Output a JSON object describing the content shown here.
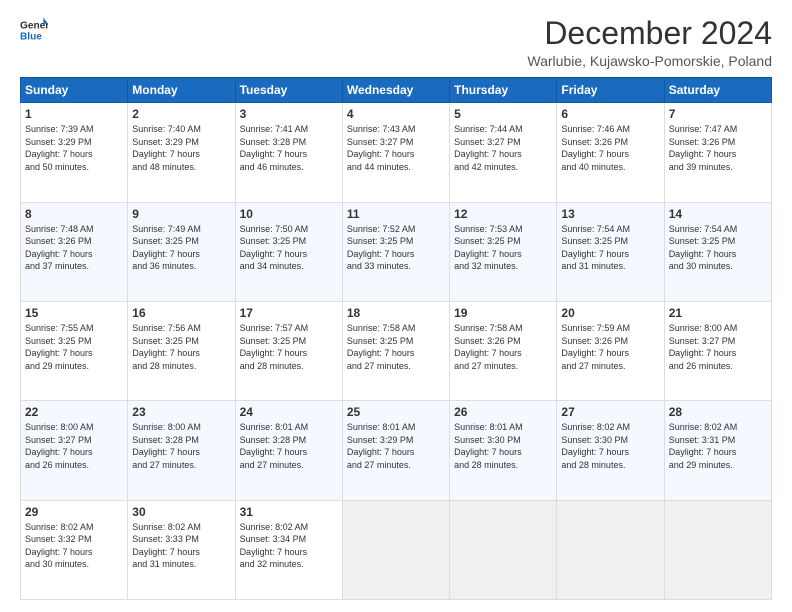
{
  "header": {
    "logo_line1": "General",
    "logo_line2": "Blue",
    "title": "December 2024",
    "subtitle": "Warlubie, Kujawsko-Pomorskie, Poland"
  },
  "columns": [
    "Sunday",
    "Monday",
    "Tuesday",
    "Wednesday",
    "Thursday",
    "Friday",
    "Saturday"
  ],
  "weeks": [
    [
      {
        "day": "1",
        "info": "Sunrise: 7:39 AM\nSunset: 3:29 PM\nDaylight: 7 hours\nand 50 minutes."
      },
      {
        "day": "2",
        "info": "Sunrise: 7:40 AM\nSunset: 3:29 PM\nDaylight: 7 hours\nand 48 minutes."
      },
      {
        "day": "3",
        "info": "Sunrise: 7:41 AM\nSunset: 3:28 PM\nDaylight: 7 hours\nand 46 minutes."
      },
      {
        "day": "4",
        "info": "Sunrise: 7:43 AM\nSunset: 3:27 PM\nDaylight: 7 hours\nand 44 minutes."
      },
      {
        "day": "5",
        "info": "Sunrise: 7:44 AM\nSunset: 3:27 PM\nDaylight: 7 hours\nand 42 minutes."
      },
      {
        "day": "6",
        "info": "Sunrise: 7:46 AM\nSunset: 3:26 PM\nDaylight: 7 hours\nand 40 minutes."
      },
      {
        "day": "7",
        "info": "Sunrise: 7:47 AM\nSunset: 3:26 PM\nDaylight: 7 hours\nand 39 minutes."
      }
    ],
    [
      {
        "day": "8",
        "info": "Sunrise: 7:48 AM\nSunset: 3:26 PM\nDaylight: 7 hours\nand 37 minutes."
      },
      {
        "day": "9",
        "info": "Sunrise: 7:49 AM\nSunset: 3:25 PM\nDaylight: 7 hours\nand 36 minutes."
      },
      {
        "day": "10",
        "info": "Sunrise: 7:50 AM\nSunset: 3:25 PM\nDaylight: 7 hours\nand 34 minutes."
      },
      {
        "day": "11",
        "info": "Sunrise: 7:52 AM\nSunset: 3:25 PM\nDaylight: 7 hours\nand 33 minutes."
      },
      {
        "day": "12",
        "info": "Sunrise: 7:53 AM\nSunset: 3:25 PM\nDaylight: 7 hours\nand 32 minutes."
      },
      {
        "day": "13",
        "info": "Sunrise: 7:54 AM\nSunset: 3:25 PM\nDaylight: 7 hours\nand 31 minutes."
      },
      {
        "day": "14",
        "info": "Sunrise: 7:54 AM\nSunset: 3:25 PM\nDaylight: 7 hours\nand 30 minutes."
      }
    ],
    [
      {
        "day": "15",
        "info": "Sunrise: 7:55 AM\nSunset: 3:25 PM\nDaylight: 7 hours\nand 29 minutes."
      },
      {
        "day": "16",
        "info": "Sunrise: 7:56 AM\nSunset: 3:25 PM\nDaylight: 7 hours\nand 28 minutes."
      },
      {
        "day": "17",
        "info": "Sunrise: 7:57 AM\nSunset: 3:25 PM\nDaylight: 7 hours\nand 28 minutes."
      },
      {
        "day": "18",
        "info": "Sunrise: 7:58 AM\nSunset: 3:25 PM\nDaylight: 7 hours\nand 27 minutes."
      },
      {
        "day": "19",
        "info": "Sunrise: 7:58 AM\nSunset: 3:26 PM\nDaylight: 7 hours\nand 27 minutes."
      },
      {
        "day": "20",
        "info": "Sunrise: 7:59 AM\nSunset: 3:26 PM\nDaylight: 7 hours\nand 27 minutes."
      },
      {
        "day": "21",
        "info": "Sunrise: 8:00 AM\nSunset: 3:27 PM\nDaylight: 7 hours\nand 26 minutes."
      }
    ],
    [
      {
        "day": "22",
        "info": "Sunrise: 8:00 AM\nSunset: 3:27 PM\nDaylight: 7 hours\nand 26 minutes."
      },
      {
        "day": "23",
        "info": "Sunrise: 8:00 AM\nSunset: 3:28 PM\nDaylight: 7 hours\nand 27 minutes."
      },
      {
        "day": "24",
        "info": "Sunrise: 8:01 AM\nSunset: 3:28 PM\nDaylight: 7 hours\nand 27 minutes."
      },
      {
        "day": "25",
        "info": "Sunrise: 8:01 AM\nSunset: 3:29 PM\nDaylight: 7 hours\nand 27 minutes."
      },
      {
        "day": "26",
        "info": "Sunrise: 8:01 AM\nSunset: 3:30 PM\nDaylight: 7 hours\nand 28 minutes."
      },
      {
        "day": "27",
        "info": "Sunrise: 8:02 AM\nSunset: 3:30 PM\nDaylight: 7 hours\nand 28 minutes."
      },
      {
        "day": "28",
        "info": "Sunrise: 8:02 AM\nSunset: 3:31 PM\nDaylight: 7 hours\nand 29 minutes."
      }
    ],
    [
      {
        "day": "29",
        "info": "Sunrise: 8:02 AM\nSunset: 3:32 PM\nDaylight: 7 hours\nand 30 minutes."
      },
      {
        "day": "30",
        "info": "Sunrise: 8:02 AM\nSunset: 3:33 PM\nDaylight: 7 hours\nand 31 minutes."
      },
      {
        "day": "31",
        "info": "Sunrise: 8:02 AM\nSunset: 3:34 PM\nDaylight: 7 hours\nand 32 minutes."
      },
      {
        "day": "",
        "info": ""
      },
      {
        "day": "",
        "info": ""
      },
      {
        "day": "",
        "info": ""
      },
      {
        "day": "",
        "info": ""
      }
    ]
  ]
}
